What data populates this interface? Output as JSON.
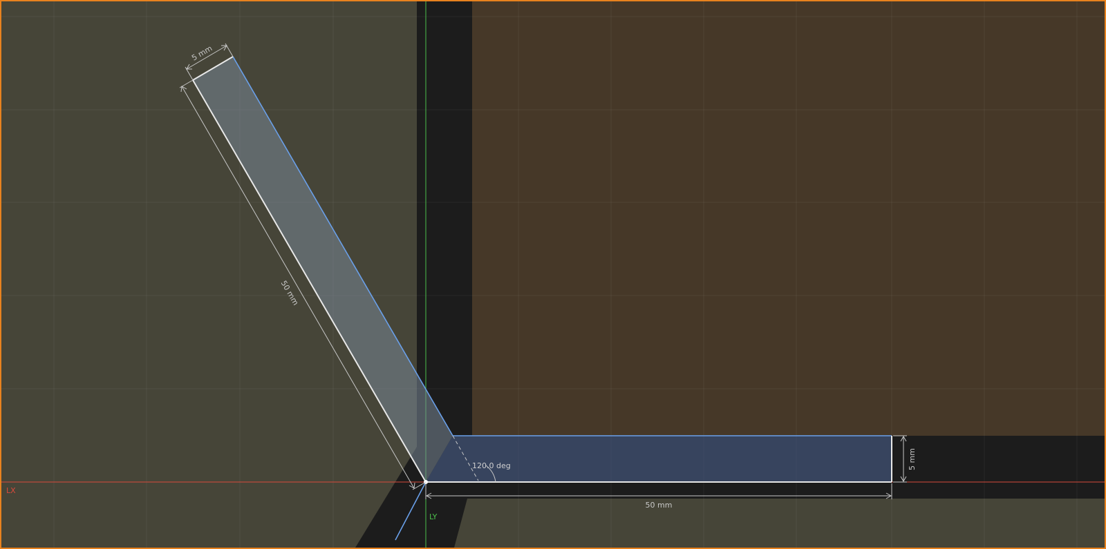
{
  "sketch": {
    "colors": {
      "background_dark": "#1c1c1c",
      "region_olive": "#464538",
      "region_brown": "#463828",
      "frame_border": "#e8821e",
      "axis_x": "#d94a3c",
      "axis_y": "#4cc04c",
      "profile_edge": "#e8e8e8",
      "construction_edge": "#6aa0ea",
      "fill_blue": "rgba(88,110,150,0.55)",
      "fill_light": "rgba(120,135,150,0.55)",
      "dimension": "#c8c8c8"
    },
    "axes": {
      "x_label": "LX",
      "y_label": "LY"
    },
    "dimensions": {
      "arm_width": "5 mm",
      "arm_length": "50 mm",
      "base_width": "5 mm",
      "base_length": "50 mm",
      "angle": "120.0 deg"
    }
  }
}
